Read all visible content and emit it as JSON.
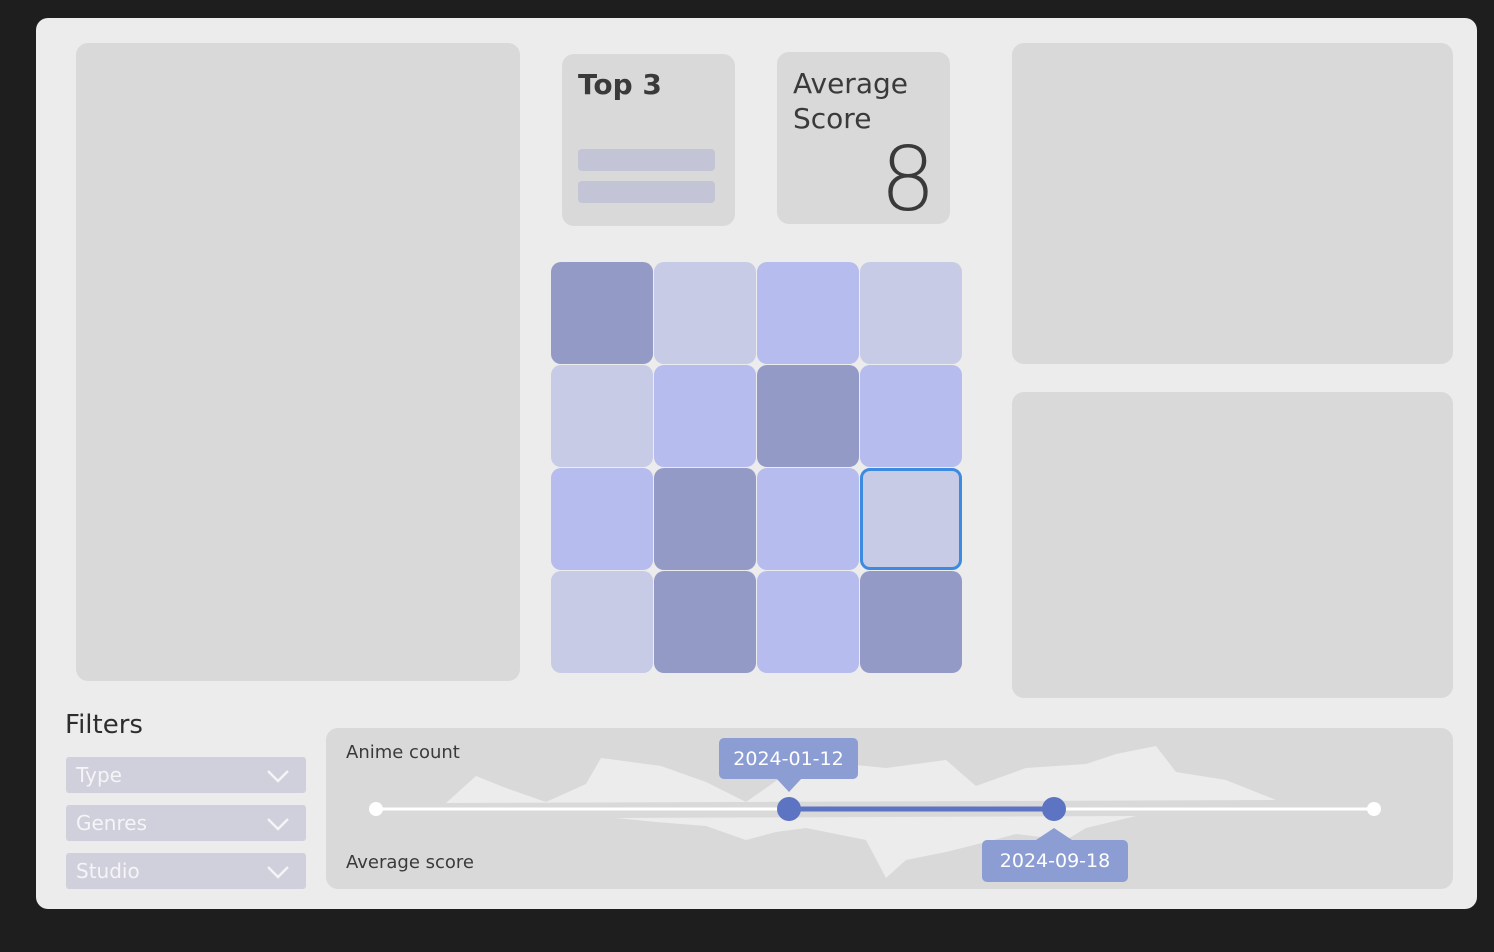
{
  "cards": {
    "top3": {
      "title": "Top 3"
    },
    "average": {
      "title_line1": "Average",
      "title_line2": "Score",
      "value": "8"
    }
  },
  "tile_grid": {
    "colors": {
      "dark": "#949ac6",
      "light": "#c7cbe6",
      "medium": "#b6bced",
      "selected_border": "#3d8be0"
    },
    "rows": [
      [
        "dark",
        "light",
        "medium",
        "light"
      ],
      [
        "light",
        "medium",
        "dark",
        "medium"
      ],
      [
        "medium",
        "dark",
        "medium",
        "light"
      ],
      [
        "light",
        "dark",
        "medium",
        "dark"
      ]
    ],
    "selected": {
      "row": 2,
      "col": 3
    }
  },
  "filters": {
    "title": "Filters",
    "selects": [
      {
        "label": "Type",
        "icon": "chevron-down-icon"
      },
      {
        "label": "Genres",
        "icon": "chevron-down-icon"
      },
      {
        "label": "Studio",
        "icon": "chevron-down-icon"
      }
    ]
  },
  "timeline": {
    "top_label": "Anime count",
    "bottom_label": "Average score",
    "range_start": "2024-01-12",
    "range_end": "2024-09-18",
    "accent_color": "#5c74c1"
  }
}
